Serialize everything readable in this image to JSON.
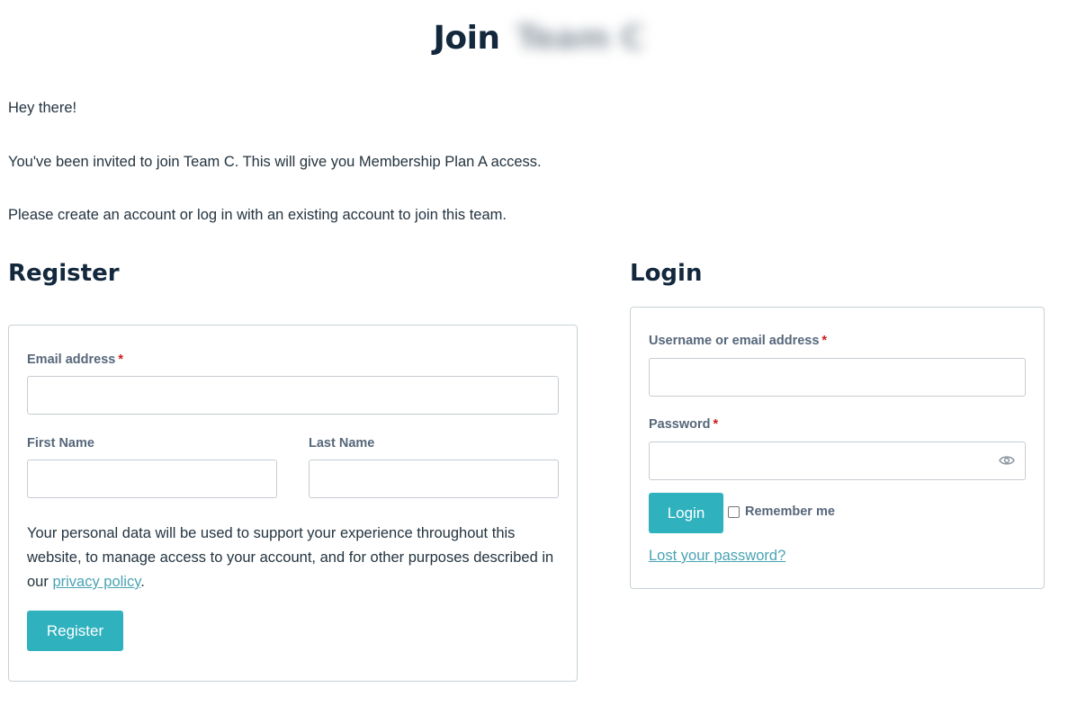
{
  "header": {
    "title_prefix": "Join",
    "title_blurred": "Team C"
  },
  "intro": {
    "greeting": "Hey there!",
    "invite": "You've been invited to join Team C. This will give you Membership Plan A access.",
    "instruction": "Please create an account or log in with an existing account to join this team."
  },
  "register": {
    "heading": "Register",
    "email_label": "Email address",
    "required_mark": "*",
    "email_value": "",
    "first_name_label": "First Name",
    "first_name_value": "",
    "last_name_label": "Last Name",
    "last_name_value": "",
    "privacy_text_before": "Your personal data will be used to support your experience throughout this website, to manage access to your account, and for other purposes described in our ",
    "privacy_link": "privacy policy",
    "privacy_text_after": ".",
    "button_label": "Register"
  },
  "login": {
    "heading": "Login",
    "username_label": "Username or email address",
    "required_mark": "*",
    "username_value": "",
    "password_label": "Password",
    "password_value": "",
    "password_toggle_icon": "eye-icon",
    "button_label": "Login",
    "remember_label": "Remember me",
    "remember_checked": false,
    "lost_password_link": "Lost your password?"
  },
  "colors": {
    "accent": "#2fb1be",
    "link": "#4aa3b3",
    "heading": "#13283d",
    "required": "#cc1b1b",
    "label": "#56677a"
  }
}
